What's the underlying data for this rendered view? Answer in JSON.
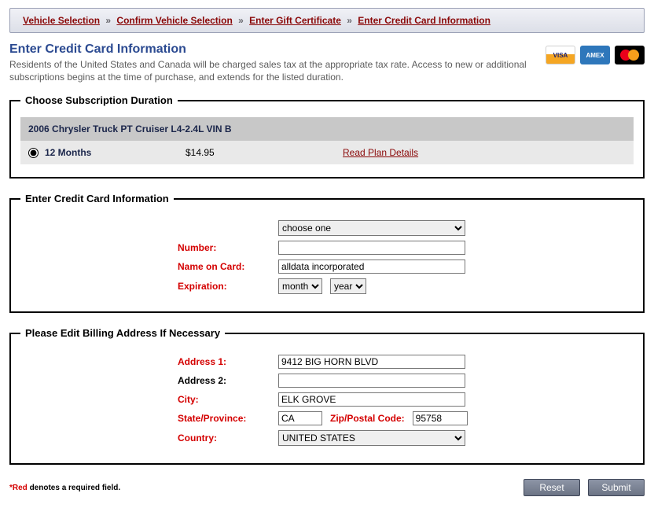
{
  "breadcrumb": {
    "items": [
      "Vehicle Selection",
      "Confirm Vehicle Selection",
      "Enter Gift Certificate",
      "Enter Credit Card Information"
    ]
  },
  "header": {
    "title": "Enter Credit Card Information",
    "description": "Residents of the United States and Canada will be charged sales tax at the appropriate tax rate. Access to new or additional subscriptions begins at the time of purchase, and extends for the listed duration."
  },
  "fieldsets": {
    "subscription": {
      "legend": "Choose Subscription Duration",
      "vehicle": "2006 Chrysler Truck PT Cruiser L4-2.4L VIN B",
      "plan": {
        "term": "12 Months",
        "price": "$14.95",
        "details_link": "Read Plan Details"
      }
    },
    "card": {
      "legend": "Enter Credit Card Information",
      "type_placeholder": "choose one",
      "labels": {
        "number": "Number:",
        "name": "Name on Card:",
        "expiration": "Expiration:"
      },
      "values": {
        "number": "",
        "name": "alldata incorporated"
      },
      "exp_month_placeholder": "month",
      "exp_year_placeholder": "year"
    },
    "billing": {
      "legend": "Please Edit Billing Address If Necessary",
      "labels": {
        "address1": "Address 1:",
        "address2": "Address 2:",
        "city": "City:",
        "state": "State/Province:",
        "zip": "Zip/Postal Code:",
        "country": "Country:"
      },
      "values": {
        "address1": "9412 BIG HORN BLVD",
        "address2": "",
        "city": "ELK GROVE",
        "state": "CA",
        "zip": "95758",
        "country": "UNITED STATES"
      }
    }
  },
  "footer": {
    "note_prefix": "*Red",
    "note_rest": " denotes a required field.",
    "buttons": {
      "reset": "Reset",
      "submit": "Submit"
    }
  },
  "card_brands": {
    "visa": "VISA",
    "amex": "AMEX",
    "mc": ""
  }
}
